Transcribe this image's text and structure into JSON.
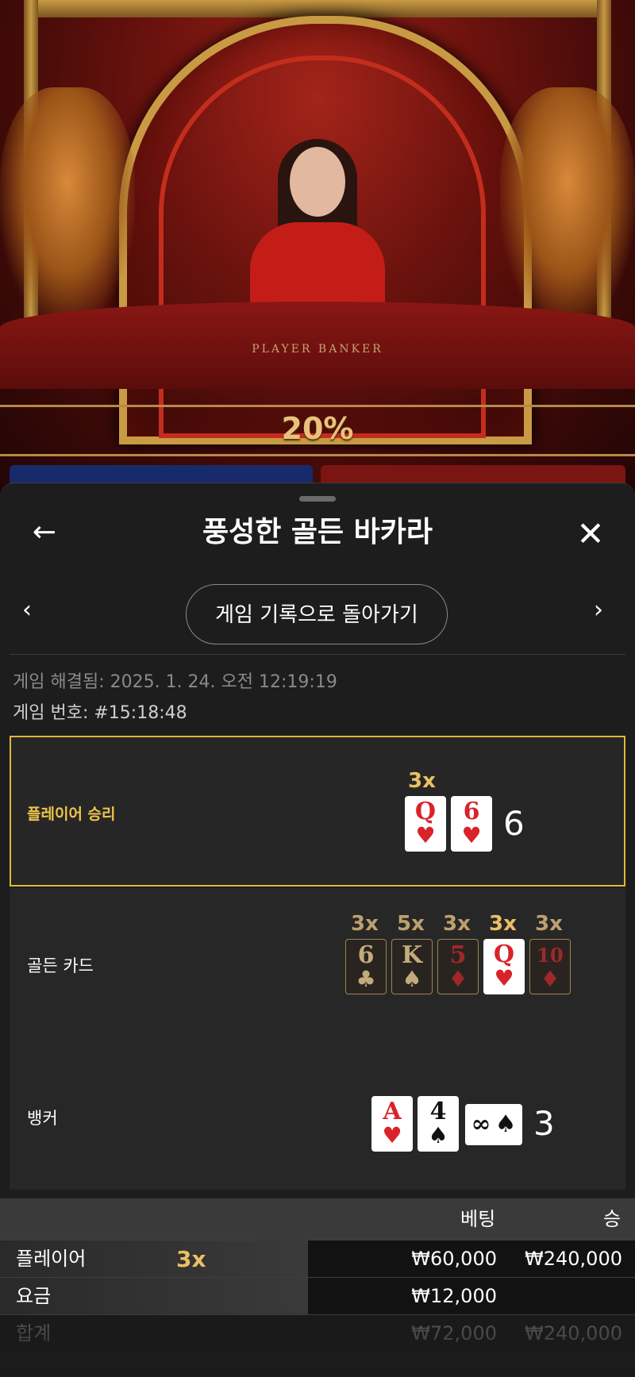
{
  "scene": {
    "table_label": "PLAYER        BANKER",
    "percent": "20%"
  },
  "sheet": {
    "back_icon": "←",
    "title": "풍성한 골든 바카라",
    "close_icon": "✕",
    "prev_icon": "‹",
    "next_icon": "›",
    "history_button": "게임 기록으로 돌아가기",
    "resolved": "게임 해결됨: 2025. 1. 24. 오전 12:19:19",
    "round": "게임 번호: #15:18:48"
  },
  "rows": {
    "player": {
      "label": "플레이어 승리",
      "multiplier": "3x",
      "cards": [
        {
          "rank": "Q",
          "suit": "♥"
        },
        {
          "rank": "6",
          "suit": "♥"
        }
      ],
      "total": "6"
    },
    "golden": {
      "label": "골든 카드",
      "cards": [
        {
          "rank": "6",
          "suit": "♣",
          "mult": "3x"
        },
        {
          "rank": "K",
          "suit": "♠",
          "mult": "5x"
        },
        {
          "rank": "5",
          "suit": "♦",
          "mult": "3x"
        },
        {
          "rank": "Q",
          "suit": "♥",
          "mult": "3x"
        },
        {
          "rank": "10",
          "suit": "♦",
          "mult": "3x"
        }
      ]
    },
    "banker": {
      "label": "뱅커",
      "cards": [
        {
          "rank": "A",
          "suit": "♥"
        },
        {
          "rank": "4",
          "suit": "♠"
        },
        {
          "rank": "∞",
          "suit": "♠"
        }
      ],
      "total": "3"
    }
  },
  "bets": {
    "headers": {
      "bet": "베팅",
      "win": "승"
    },
    "player": {
      "label": "플레이어",
      "multiplier": "3x",
      "bet": "₩60,000",
      "win": "₩240,000"
    },
    "fee": {
      "label": "요금",
      "bet": "₩12,000"
    },
    "total": {
      "label": "합계",
      "bet": "₩72,000",
      "win": "₩240,000"
    }
  },
  "colors": {
    "accent_gold": "#e2b63b",
    "multiplier_gold": "#e7c06a",
    "card_red": "#d8232a"
  }
}
